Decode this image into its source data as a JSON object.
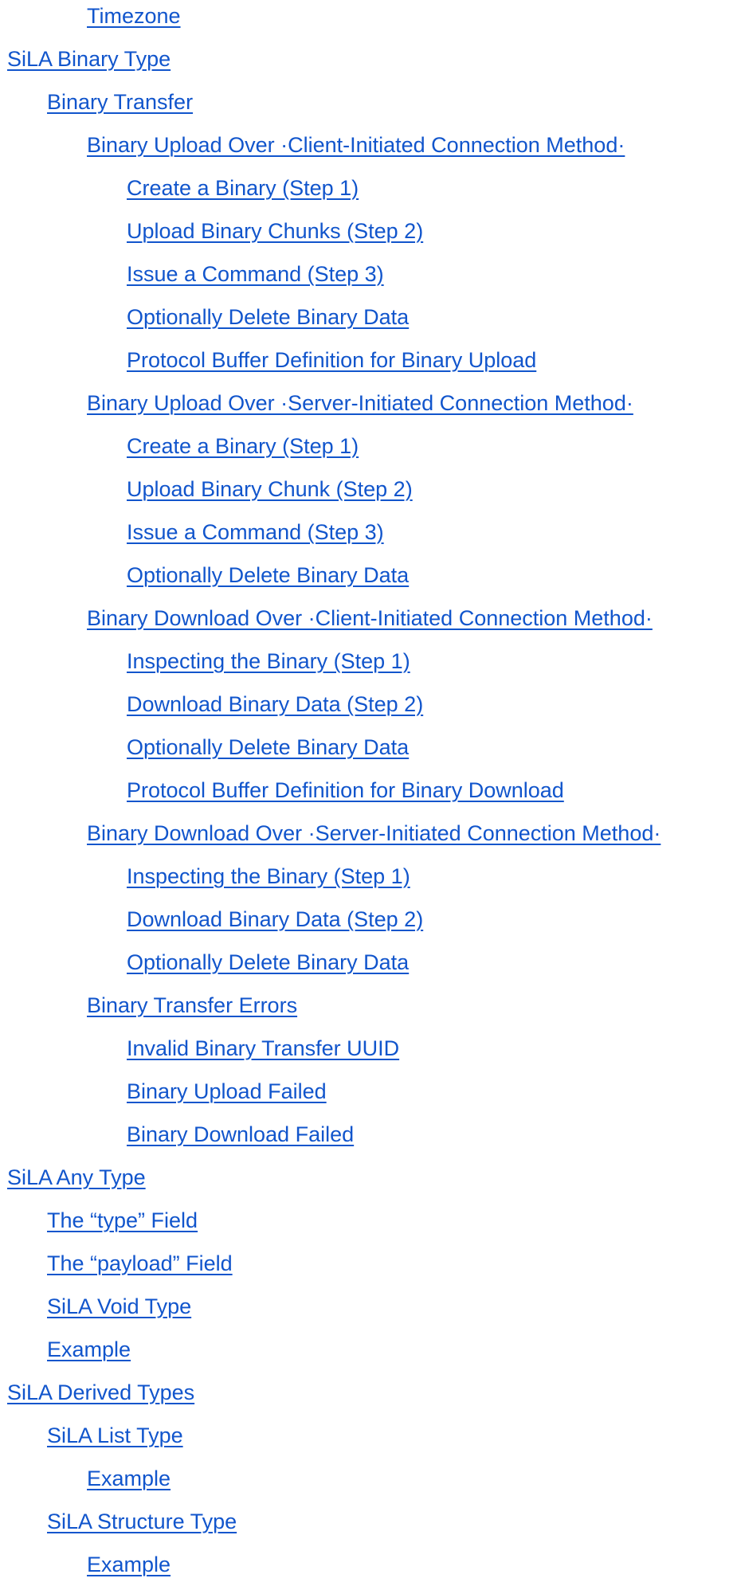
{
  "toc": [
    {
      "label": "Timezone",
      "level": 2
    },
    {
      "label": "SiLA Binary Type",
      "level": 0
    },
    {
      "label": "Binary Transfer",
      "level": 1
    },
    {
      "label": "Binary Upload Over ·Client-Initiated Connection Method·",
      "level": 2
    },
    {
      "label": "Create a Binary (Step 1)",
      "level": 3
    },
    {
      "label": "Upload Binary Chunks (Step 2)",
      "level": 3
    },
    {
      "label": "Issue a Command (Step 3)",
      "level": 3
    },
    {
      "label": "Optionally Delete Binary Data",
      "level": 3
    },
    {
      "label": "Protocol Buffer Definition for Binary Upload",
      "level": 3
    },
    {
      "label": "Binary Upload Over ·Server-Initiated Connection Method·",
      "level": 2
    },
    {
      "label": "Create a Binary (Step 1)",
      "level": 3
    },
    {
      "label": "Upload Binary Chunk (Step 2)",
      "level": 3
    },
    {
      "label": "Issue a Command (Step 3)",
      "level": 3
    },
    {
      "label": "Optionally Delete Binary Data",
      "level": 3
    },
    {
      "label": "Binary Download Over ·Client-Initiated Connection Method·",
      "level": 2
    },
    {
      "label": "Inspecting the Binary (Step 1)",
      "level": 3
    },
    {
      "label": "Download Binary Data (Step 2)",
      "level": 3
    },
    {
      "label": "Optionally Delete Binary Data",
      "level": 3
    },
    {
      "label": "Protocol Buffer Definition for Binary Download",
      "level": 3
    },
    {
      "label": "Binary Download Over ·Server-Initiated Connection Method·",
      "level": 2
    },
    {
      "label": "Inspecting the Binary (Step 1)",
      "level": 3
    },
    {
      "label": "Download Binary Data (Step 2)",
      "level": 3
    },
    {
      "label": "Optionally Delete Binary Data",
      "level": 3
    },
    {
      "label": "Binary Transfer Errors",
      "level": 2
    },
    {
      "label": "Invalid Binary Transfer UUID",
      "level": 3
    },
    {
      "label": "Binary Upload Failed",
      "level": 3
    },
    {
      "label": "Binary Download Failed",
      "level": 3
    },
    {
      "label": "SiLA Any Type",
      "level": 0
    },
    {
      "label": "The “type” Field",
      "level": 1
    },
    {
      "label": "The “payload” Field",
      "level": 1
    },
    {
      "label": "SiLA Void Type",
      "level": 1
    },
    {
      "label": "Example",
      "level": 1
    },
    {
      "label": "SiLA Derived Types",
      "level": 0
    },
    {
      "label": "SiLA List Type",
      "level": 1
    },
    {
      "label": "Example",
      "level": 2
    },
    {
      "label": "SiLA Structure Type",
      "level": 1
    },
    {
      "label": "Example",
      "level": 2
    }
  ],
  "colors": {
    "link": "#1155cc",
    "background": "#ffffff"
  }
}
